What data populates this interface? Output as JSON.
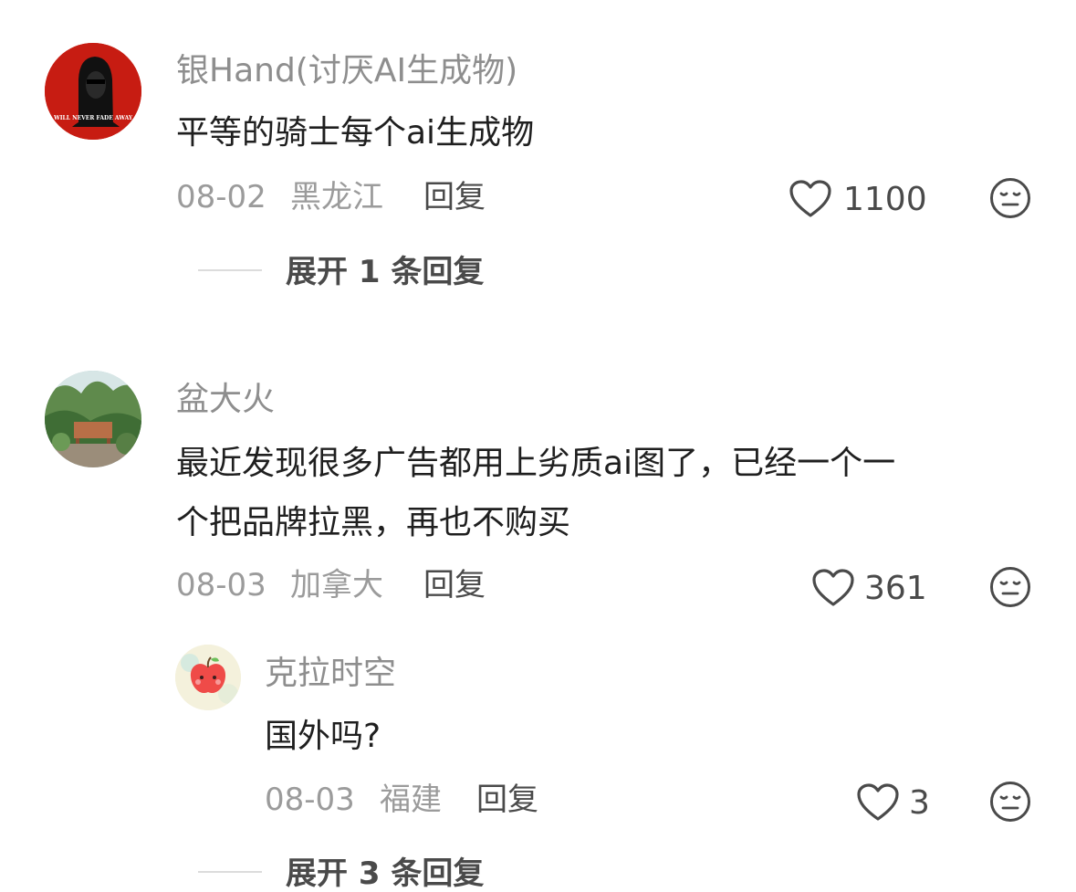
{
  "comments": [
    {
      "username": "银Hand(讨厌AI生成物)",
      "avatar_caption": "WILL NEVER FADE AWAY",
      "lines": [
        "平等的骑士每个ai生成物"
      ],
      "date": "08-02",
      "location": "黑龙江",
      "reply_label": "回复",
      "likes": "1100",
      "expand_label": "展开 1 条回复"
    },
    {
      "username": "盆大火",
      "lines": [
        "最近发现很多广告都用上劣质ai图了，已经一个一",
        "个把品牌拉黑，再也不购买"
      ],
      "date": "08-03",
      "location": "加拿大",
      "reply_label": "回复",
      "likes": "361",
      "reply": {
        "username": "克拉时空",
        "lines": [
          "国外吗?"
        ],
        "date": "08-03",
        "location": "福建",
        "reply_label": "回复",
        "likes": "3"
      },
      "expand_label": "展开 3 条回复"
    }
  ],
  "icons": {
    "like": "heart-outline-icon",
    "dislike": "neutral-face-icon"
  },
  "colors": {
    "username": "#8e8e8e",
    "content": "#1f1f1f",
    "meta": "#9b9b9b",
    "action": "#4a4a4a"
  }
}
